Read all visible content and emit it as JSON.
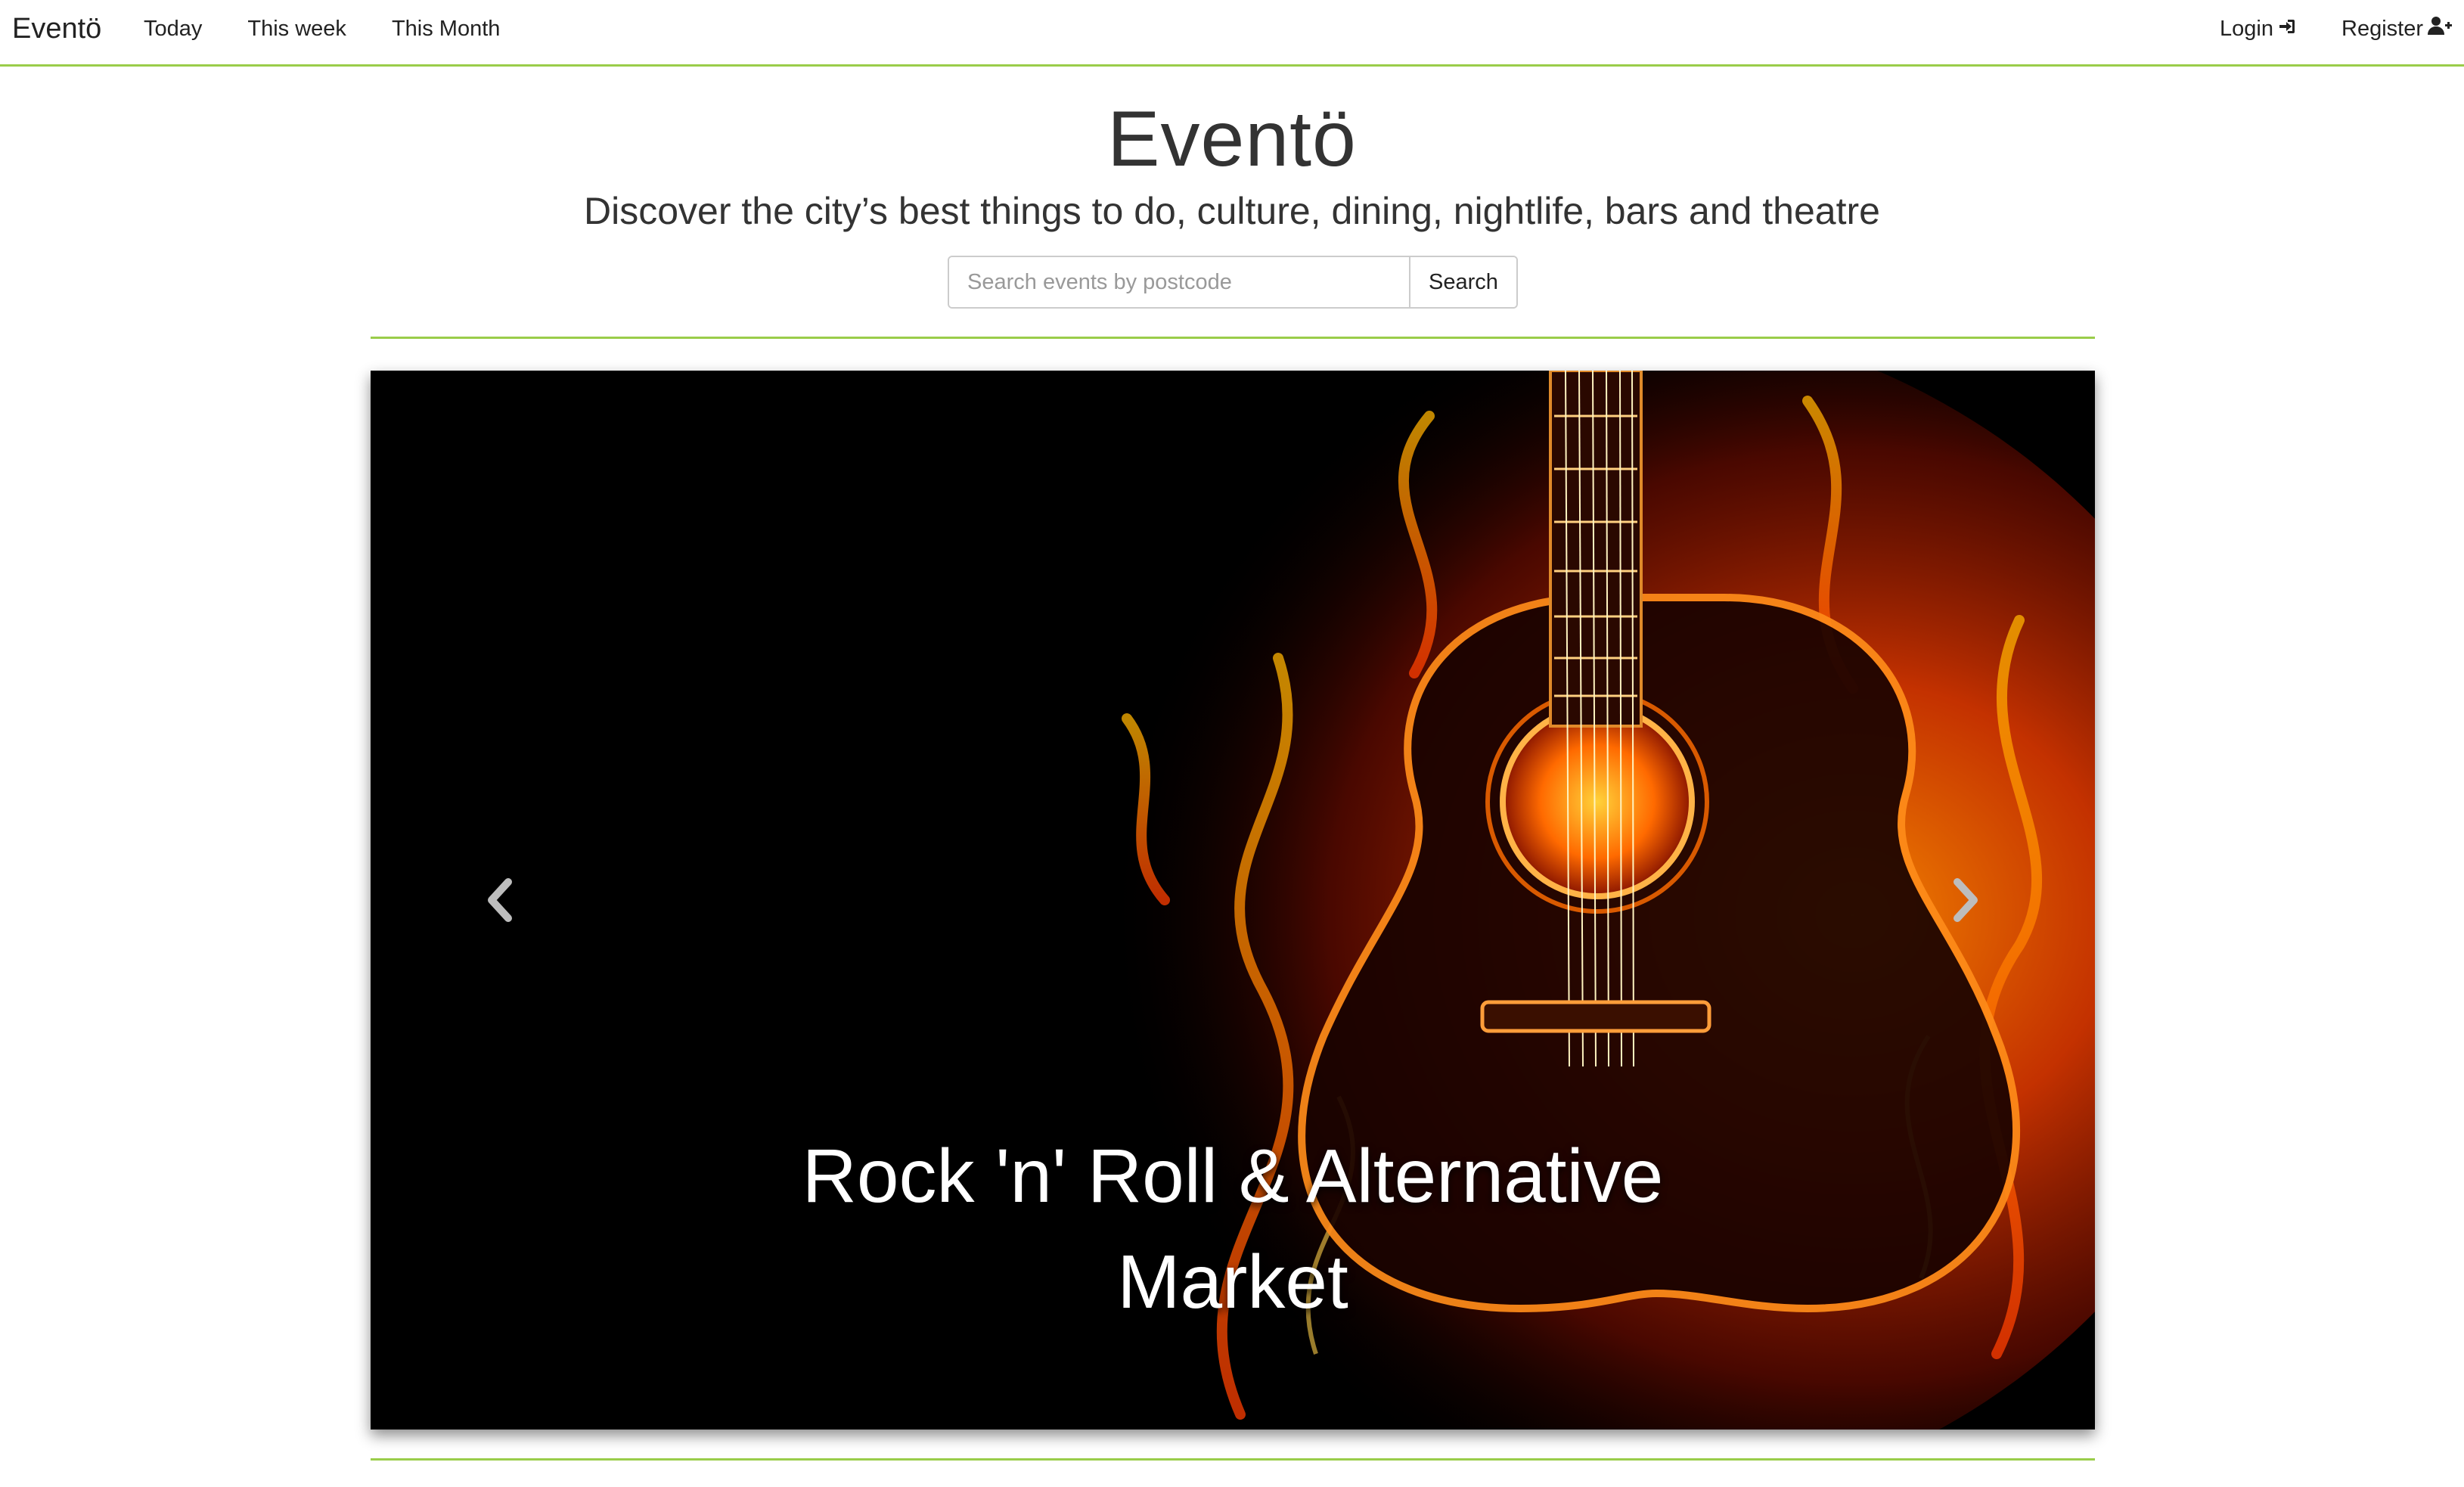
{
  "navbar": {
    "brand": "Eventö",
    "links": [
      "Today",
      "This week",
      "This Month"
    ],
    "login_label": "Login",
    "register_label": "Register"
  },
  "header": {
    "title": "Eventö",
    "subtitle": "Discover the city’s best things to do, culture, dining, nightlife, bars and theatre",
    "search": {
      "placeholder": "Search events by postcode",
      "value": "",
      "button_label": "Search"
    }
  },
  "carousel": {
    "caption": "Rock 'n' Roll & Alternative Market",
    "image_icon": "flaming-guitar-image",
    "prev_icon": "chevron-left-icon",
    "next_icon": "chevron-right-icon"
  },
  "colors": {
    "accent": "#9acd4a",
    "text": "#333333",
    "flame": "#ff5a00"
  }
}
